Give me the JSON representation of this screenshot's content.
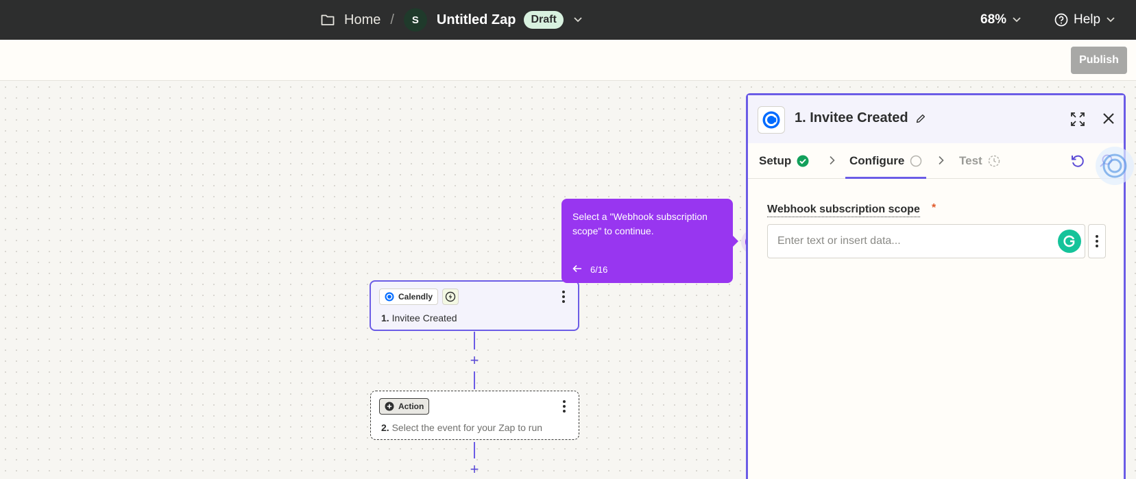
{
  "topbar": {
    "home_label": "Home",
    "separator": "/",
    "avatar_initial": "S",
    "zap_title": "Untitled Zap",
    "status_badge": "Draft",
    "zoom_level": "68%",
    "help_label": "Help"
  },
  "subbar": {
    "publish_label": "Publish"
  },
  "canvas": {
    "trigger_node": {
      "app_name": "Calendly",
      "step_number": "1.",
      "title": "Invitee Created"
    },
    "action_node": {
      "badge_label": "Action",
      "step_number": "2.",
      "title": "Select the event for your Zap to run"
    }
  },
  "tooltip": {
    "message": "Select a \"Webhook subscription scope\" to continue.",
    "progress": "6/16"
  },
  "panel": {
    "title": "1. Invitee Created",
    "tabs": [
      {
        "label": "Setup",
        "state": "complete"
      },
      {
        "label": "Configure",
        "state": "active"
      },
      {
        "label": "Test",
        "state": "pending"
      }
    ],
    "field": {
      "label": "Webhook subscription scope",
      "required_mark": "*",
      "placeholder": "Enter text or insert data..."
    }
  },
  "colors": {
    "topbar_bg": "#2d2e2e",
    "accent_purple": "#6b5ce6",
    "tooltip_purple": "#9836f0",
    "success_green": "#12a05b",
    "publish_disabled": "#a8a8a6",
    "draft_badge_bg": "#d8f1df"
  },
  "icons": [
    "folder-icon",
    "chevron-down-icon",
    "help-circle-icon",
    "lightning-icon",
    "plus-icon",
    "kebab-icon",
    "calendly-logo-icon",
    "pencil-icon",
    "expand-icon",
    "close-icon",
    "check-circle-icon",
    "chevron-right-icon",
    "circle-icon",
    "timer-icon",
    "refresh-icon",
    "search-icon",
    "grammarly-icon",
    "arrow-left-icon"
  ]
}
